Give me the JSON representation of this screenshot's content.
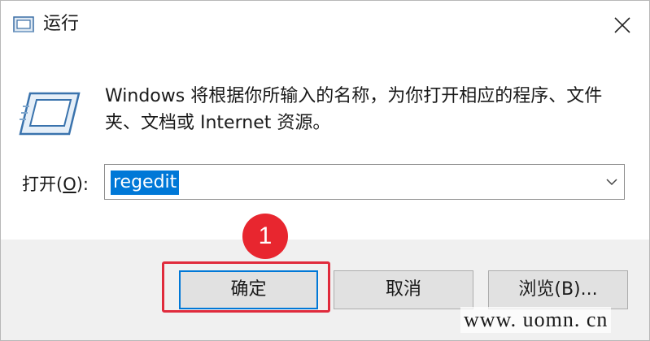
{
  "window": {
    "title": "运行"
  },
  "description": "Windows 将根据你所输入的名称，为你打开相应的程序、文件夹、文档或 Internet 资源。",
  "open_field": {
    "label_prefix": "打开(",
    "label_accel": "O",
    "label_suffix": "):",
    "value": "regedit"
  },
  "buttons": {
    "ok": "确定",
    "cancel": "取消",
    "browse": "浏览(B)..."
  },
  "annotation": {
    "step_number": "1",
    "color": "#e8262f"
  },
  "watermark": "www. uomn. cn",
  "colors": {
    "accent": "#0078d7",
    "footer_bg": "#f0f0f0"
  }
}
